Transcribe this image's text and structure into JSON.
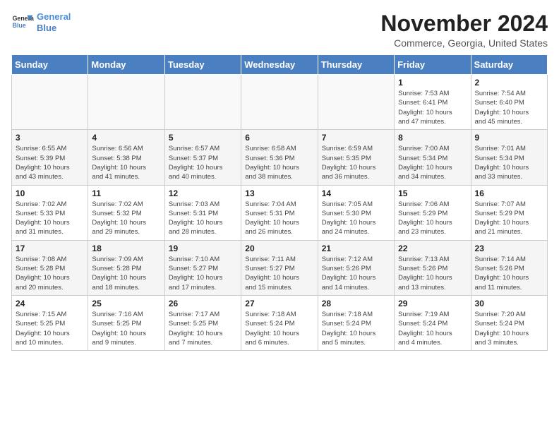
{
  "logo": {
    "line1": "General",
    "line2": "Blue"
  },
  "title": "November 2024",
  "location": "Commerce, Georgia, United States",
  "days_header": [
    "Sunday",
    "Monday",
    "Tuesday",
    "Wednesday",
    "Thursday",
    "Friday",
    "Saturday"
  ],
  "weeks": [
    [
      {
        "day": "",
        "info": ""
      },
      {
        "day": "",
        "info": ""
      },
      {
        "day": "",
        "info": ""
      },
      {
        "day": "",
        "info": ""
      },
      {
        "day": "",
        "info": ""
      },
      {
        "day": "1",
        "info": "Sunrise: 7:53 AM\nSunset: 6:41 PM\nDaylight: 10 hours\nand 47 minutes."
      },
      {
        "day": "2",
        "info": "Sunrise: 7:54 AM\nSunset: 6:40 PM\nDaylight: 10 hours\nand 45 minutes."
      }
    ],
    [
      {
        "day": "3",
        "info": "Sunrise: 6:55 AM\nSunset: 5:39 PM\nDaylight: 10 hours\nand 43 minutes."
      },
      {
        "day": "4",
        "info": "Sunrise: 6:56 AM\nSunset: 5:38 PM\nDaylight: 10 hours\nand 41 minutes."
      },
      {
        "day": "5",
        "info": "Sunrise: 6:57 AM\nSunset: 5:37 PM\nDaylight: 10 hours\nand 40 minutes."
      },
      {
        "day": "6",
        "info": "Sunrise: 6:58 AM\nSunset: 5:36 PM\nDaylight: 10 hours\nand 38 minutes."
      },
      {
        "day": "7",
        "info": "Sunrise: 6:59 AM\nSunset: 5:35 PM\nDaylight: 10 hours\nand 36 minutes."
      },
      {
        "day": "8",
        "info": "Sunrise: 7:00 AM\nSunset: 5:34 PM\nDaylight: 10 hours\nand 34 minutes."
      },
      {
        "day": "9",
        "info": "Sunrise: 7:01 AM\nSunset: 5:34 PM\nDaylight: 10 hours\nand 33 minutes."
      }
    ],
    [
      {
        "day": "10",
        "info": "Sunrise: 7:02 AM\nSunset: 5:33 PM\nDaylight: 10 hours\nand 31 minutes."
      },
      {
        "day": "11",
        "info": "Sunrise: 7:02 AM\nSunset: 5:32 PM\nDaylight: 10 hours\nand 29 minutes."
      },
      {
        "day": "12",
        "info": "Sunrise: 7:03 AM\nSunset: 5:31 PM\nDaylight: 10 hours\nand 28 minutes."
      },
      {
        "day": "13",
        "info": "Sunrise: 7:04 AM\nSunset: 5:31 PM\nDaylight: 10 hours\nand 26 minutes."
      },
      {
        "day": "14",
        "info": "Sunrise: 7:05 AM\nSunset: 5:30 PM\nDaylight: 10 hours\nand 24 minutes."
      },
      {
        "day": "15",
        "info": "Sunrise: 7:06 AM\nSunset: 5:29 PM\nDaylight: 10 hours\nand 23 minutes."
      },
      {
        "day": "16",
        "info": "Sunrise: 7:07 AM\nSunset: 5:29 PM\nDaylight: 10 hours\nand 21 minutes."
      }
    ],
    [
      {
        "day": "17",
        "info": "Sunrise: 7:08 AM\nSunset: 5:28 PM\nDaylight: 10 hours\nand 20 minutes."
      },
      {
        "day": "18",
        "info": "Sunrise: 7:09 AM\nSunset: 5:28 PM\nDaylight: 10 hours\nand 18 minutes."
      },
      {
        "day": "19",
        "info": "Sunrise: 7:10 AM\nSunset: 5:27 PM\nDaylight: 10 hours\nand 17 minutes."
      },
      {
        "day": "20",
        "info": "Sunrise: 7:11 AM\nSunset: 5:27 PM\nDaylight: 10 hours\nand 15 minutes."
      },
      {
        "day": "21",
        "info": "Sunrise: 7:12 AM\nSunset: 5:26 PM\nDaylight: 10 hours\nand 14 minutes."
      },
      {
        "day": "22",
        "info": "Sunrise: 7:13 AM\nSunset: 5:26 PM\nDaylight: 10 hours\nand 13 minutes."
      },
      {
        "day": "23",
        "info": "Sunrise: 7:14 AM\nSunset: 5:26 PM\nDaylight: 10 hours\nand 11 minutes."
      }
    ],
    [
      {
        "day": "24",
        "info": "Sunrise: 7:15 AM\nSunset: 5:25 PM\nDaylight: 10 hours\nand 10 minutes."
      },
      {
        "day": "25",
        "info": "Sunrise: 7:16 AM\nSunset: 5:25 PM\nDaylight: 10 hours\nand 9 minutes."
      },
      {
        "day": "26",
        "info": "Sunrise: 7:17 AM\nSunset: 5:25 PM\nDaylight: 10 hours\nand 7 minutes."
      },
      {
        "day": "27",
        "info": "Sunrise: 7:18 AM\nSunset: 5:24 PM\nDaylight: 10 hours\nand 6 minutes."
      },
      {
        "day": "28",
        "info": "Sunrise: 7:18 AM\nSunset: 5:24 PM\nDaylight: 10 hours\nand 5 minutes."
      },
      {
        "day": "29",
        "info": "Sunrise: 7:19 AM\nSunset: 5:24 PM\nDaylight: 10 hours\nand 4 minutes."
      },
      {
        "day": "30",
        "info": "Sunrise: 7:20 AM\nSunset: 5:24 PM\nDaylight: 10 hours\nand 3 minutes."
      }
    ]
  ]
}
